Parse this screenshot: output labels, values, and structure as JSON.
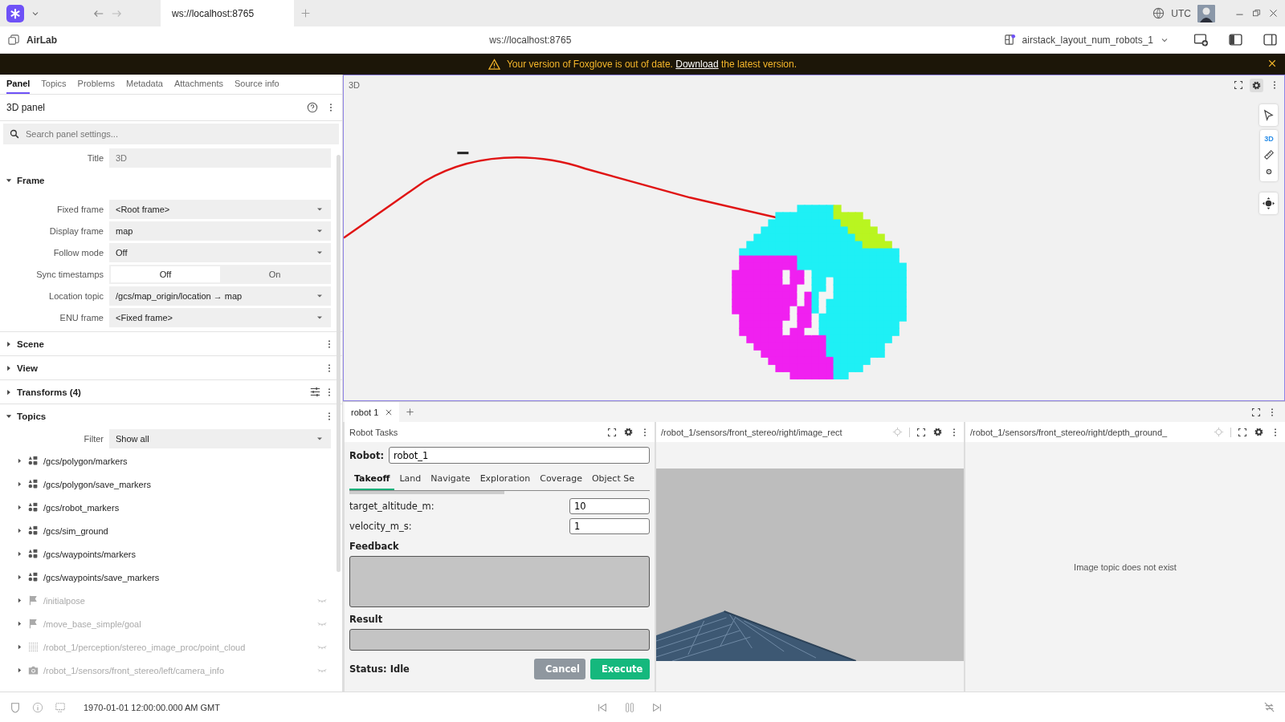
{
  "browser": {
    "tab_title": "ws://localhost:8765",
    "timezone": "UTC"
  },
  "app_bar": {
    "workspace": "AirLab",
    "url": "ws://localhost:8765",
    "layout": "airstack_layout_num_robots_1"
  },
  "banner": {
    "text_before": "Your version of Foxglove is out of date.",
    "link": "Download",
    "text_after": "the latest version."
  },
  "sidebar": {
    "tabs": [
      {
        "label": "Panel",
        "selected": true
      },
      {
        "label": "Topics",
        "selected": false
      },
      {
        "label": "Problems",
        "selected": false
      },
      {
        "label": "Metadata",
        "selected": false
      },
      {
        "label": "Attachments",
        "selected": false
      },
      {
        "label": "Source info",
        "selected": false
      }
    ],
    "panel_title": "3D panel",
    "search": {
      "placeholder": "Search panel settings..."
    },
    "title_field": {
      "label": "Title",
      "placeholder": "3D"
    },
    "sections": [
      {
        "kind": "frame",
        "title": "Frame",
        "expanded": true,
        "fields": [
          {
            "kind": "select",
            "label": "Fixed frame",
            "value": "<Root frame>"
          },
          {
            "kind": "select",
            "label": "Display frame",
            "value": "map"
          },
          {
            "kind": "select",
            "label": "Follow mode",
            "value": "Off"
          },
          {
            "kind": "toggle",
            "label": "Sync timestamps",
            "options": [
              {
                "label": "Off",
                "selected": true
              },
              {
                "label": "On",
                "selected": false
              }
            ]
          },
          {
            "kind": "select",
            "label": "Location topic",
            "value": "/gcs/map_origin/location → map"
          },
          {
            "kind": "select",
            "label": "ENU frame",
            "value": "<Fixed frame>"
          }
        ]
      },
      {
        "kind": "plain",
        "title": "Scene",
        "expanded": false
      },
      {
        "kind": "plain",
        "title": "View",
        "expanded": false
      },
      {
        "kind": "transforms",
        "title": "Transforms (4)",
        "expanded": false
      },
      {
        "kind": "topics",
        "title": "Topics",
        "expanded": true,
        "filter": {
          "label": "Filter",
          "value": "Show all"
        },
        "topics": [
          {
            "kind": "markers",
            "path": "/gcs/polygon/markers",
            "visible": true
          },
          {
            "kind": "markers",
            "path": "/gcs/polygon/save_markers",
            "visible": true
          },
          {
            "kind": "markers",
            "path": "/gcs/robot_markers",
            "visible": true
          },
          {
            "kind": "markers",
            "path": "/gcs/sim_ground",
            "visible": true
          },
          {
            "kind": "markers",
            "path": "/gcs/waypoints/markers",
            "visible": true
          },
          {
            "kind": "markers",
            "path": "/gcs/waypoints/save_markers",
            "visible": true
          },
          {
            "kind": "flag",
            "path": "/initialpose",
            "visible": false
          },
          {
            "kind": "flag",
            "path": "/move_base_simple/goal",
            "visible": false
          },
          {
            "kind": "pointcloud",
            "path": "/robot_1/perception/stereo_image_proc/point_cloud",
            "visible": false
          },
          {
            "kind": "camera",
            "path": "/robot_1/sensors/front_stereo/left/camera_info",
            "visible": false
          }
        ]
      }
    ]
  },
  "scene_panel": {
    "title": "3D",
    "toolbar_label": "3D"
  },
  "bottom": {
    "tabs": [
      {
        "label": "robot 1",
        "selected": true
      }
    ],
    "robot_tasks": {
      "title": "Robot Tasks",
      "robot_label": "Robot:",
      "robot_value": "robot_1",
      "tabs": [
        {
          "label": "Takeoff",
          "selected": true
        },
        {
          "label": "Land",
          "selected": false
        },
        {
          "label": "Navigate",
          "selected": false
        },
        {
          "label": "Exploration",
          "selected": false
        },
        {
          "label": "Coverage",
          "selected": false
        },
        {
          "label": "Object Se",
          "selected": false
        }
      ],
      "params": [
        {
          "label": "target_altitude_m:",
          "value": "10"
        },
        {
          "label": "velocity_m_s:",
          "value": "1"
        }
      ],
      "feedback_label": "Feedback",
      "result_label": "Result",
      "status": "Status: Idle",
      "buttons": [
        {
          "kind": "cancel",
          "label": "Cancel",
          "disabled": true
        },
        {
          "kind": "execute",
          "label": "Execute",
          "disabled": false
        }
      ]
    },
    "image_panels": [
      {
        "title": "/robot_1/sensors/front_stereo/right/image_rect"
      },
      {
        "title": "/robot_1/sensors/front_stereo/right/depth_ground_",
        "kind": "message",
        "message": "Image topic does not exist"
      }
    ]
  },
  "status_bar": {
    "time": "1970-01-01 12:00:00.000 AM GMT"
  }
}
